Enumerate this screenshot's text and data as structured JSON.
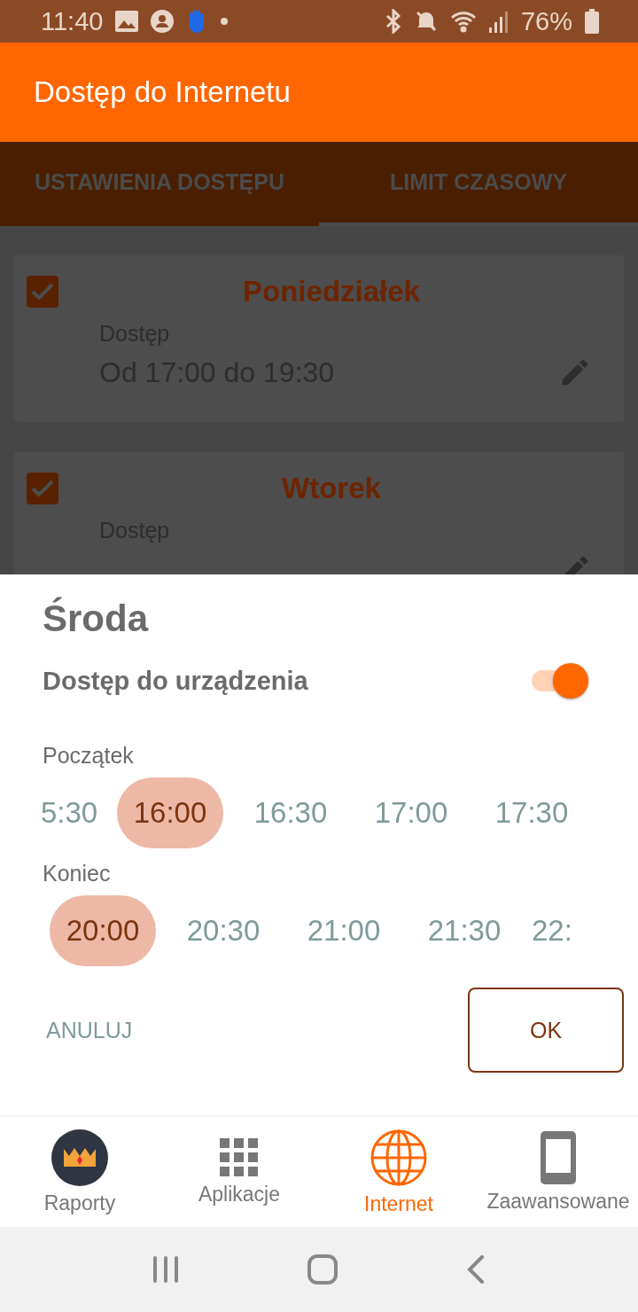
{
  "status_bar": {
    "time": "11:40",
    "battery": "76%"
  },
  "app_bar": {
    "title": "Dostęp do Internetu"
  },
  "tabs": [
    {
      "label": "USTAWIENIA DOSTĘPU",
      "selected": true
    },
    {
      "label": "LIMIT CZASOWY",
      "selected": false
    }
  ],
  "days": [
    {
      "name": "Poniedziałek",
      "checked": true,
      "label": "Dostęp",
      "range": "Od 17:00 do 19:30"
    },
    {
      "name": "Wtorek",
      "checked": true,
      "label": "Dostęp"
    }
  ],
  "sheet": {
    "title": "Środa",
    "toggle_label": "Dostęp do urządzenia",
    "toggle_on": true,
    "start_label": "Początek",
    "start_times": [
      {
        "label": "5:30",
        "selected": false
      },
      {
        "label": "16:00",
        "selected": true
      },
      {
        "label": "16:30",
        "selected": false
      },
      {
        "label": "17:00",
        "selected": false
      },
      {
        "label": "17:30",
        "selected": false
      }
    ],
    "end_label": "Koniec",
    "end_times": [
      {
        "label": "20:00",
        "selected": true
      },
      {
        "label": "20:30",
        "selected": false
      },
      {
        "label": "21:00",
        "selected": false
      },
      {
        "label": "21:30",
        "selected": false
      },
      {
        "label": "22:",
        "selected": false
      }
    ],
    "cancel": "ANULUJ",
    "ok": "OK"
  },
  "bottom_nav": [
    {
      "kind": "crown",
      "label": "Raporty",
      "selected": false
    },
    {
      "kind": "grid",
      "label": "Aplikacje",
      "selected": false
    },
    {
      "kind": "globe",
      "label": "Internet",
      "selected": true
    },
    {
      "kind": "phone",
      "label": "Zaawansowane",
      "selected": false
    }
  ]
}
